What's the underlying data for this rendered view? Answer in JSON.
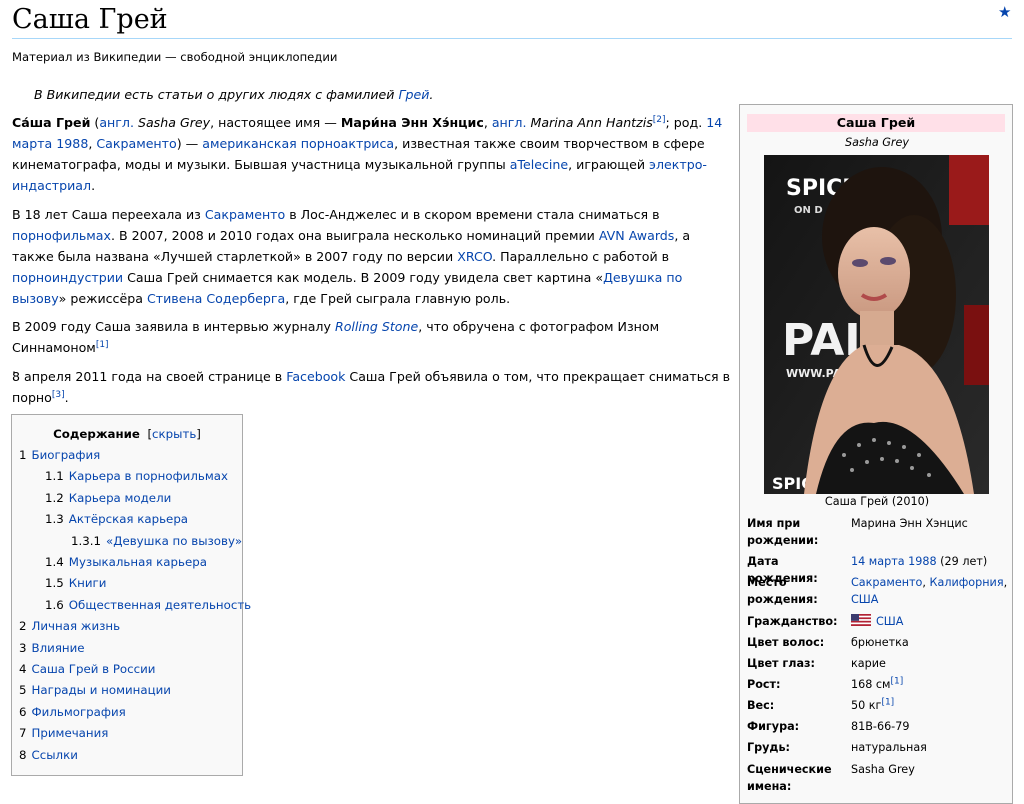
{
  "header": {
    "title": "Саша Грей",
    "tagline": "Материал из Википедии — свободной энциклопедии",
    "star_icon": "★"
  },
  "hatnote": {
    "text": "В Википедии есть статьи о других людях с фамилией ",
    "link": "Грей",
    "end": "."
  },
  "p1": {
    "name_bold": "Са́ша Грей",
    "t1": " (",
    "l1": "англ.",
    "t2": " ",
    "i1": "Sasha Grey",
    "t3": ", настоящее имя — ",
    "b2": "Мари́на Энн Хэ́нцис",
    "t4": ", ",
    "l2": "англ.",
    "t5": " ",
    "i2": "Marina Ann Hantzis",
    "s1": "[2]",
    "t6": "; род. ",
    "l3": "14 марта",
    "t7": " ",
    "l4": "1988",
    "t8": ", ",
    "l5": "Сакраменто",
    "t9": ") — ",
    "l6": "американская",
    "t10": " ",
    "l7": "порноактриса",
    "t11": ", известная также своим творчеством в сфере кинематографа, моды и музыки. Бывшая участница музыкальной группы ",
    "l8": "aTelecine",
    "t12": ", играющей ",
    "l9": "электро-индастриал",
    "t13": "."
  },
  "p2": {
    "t1": "В 18 лет Саша переехала из ",
    "l1": "Сакраменто",
    "t2": " в Лос-Анджелес и в скором времени стала сниматься в ",
    "l2": "порнофильмах",
    "t3": ". В 2007, 2008 и 2010 годах она выиграла несколько номинаций премии ",
    "l3": "AVN Awards",
    "t4": ", а также была названа «Лучшей старлеткой» в 2007 году по версии ",
    "l4": "XRCO",
    "t5": ". Параллельно с работой в ",
    "l5": "порноиндустрии",
    "t6": " Саша Грей снимается как модель. В 2009 году увидела свет картина «",
    "l6": "Девушка по вызову",
    "t7": "» режиссёра ",
    "l7": "Стивена Содерберга",
    "t8": ", где Грей сыграла главную роль."
  },
  "p3": {
    "t1": "В 2009 году Саша заявила в интервью журналу ",
    "l1": "Rolling Stone",
    "t2": ", что обручена с фотографом Изном Синнамоном",
    "s1": "[1]",
    "t3": "."
  },
  "p4": {
    "t1": "8 апреля 2011 года на своей странице в ",
    "l1": "Facebook",
    "t2": " Саша Грей объявила о том, что прекращает сниматься в порно",
    "s1": "[3]",
    "t3": "."
  },
  "toc": {
    "title": "Содержание",
    "open": "[",
    "toggle": "скрыть",
    "close": "]",
    "items": [
      {
        "num": "1",
        "label": "Биография"
      },
      {
        "num": "1.1",
        "label": "Карьера в порнофильмах"
      },
      {
        "num": "1.2",
        "label": "Карьера модели"
      },
      {
        "num": "1.3",
        "label": "Актёрская карьера"
      },
      {
        "num": "1.3.1",
        "label": "«Девушка по вызову»"
      },
      {
        "num": "1.4",
        "label": "Музыкальная карьера"
      },
      {
        "num": "1.5",
        "label": "Книги"
      },
      {
        "num": "1.6",
        "label": "Общественная деятельность"
      },
      {
        "num": "2",
        "label": "Личная жизнь"
      },
      {
        "num": "3",
        "label": "Влияние"
      },
      {
        "num": "4",
        "label": "Саша Грей в России"
      },
      {
        "num": "5",
        "label": "Награды и номинации"
      },
      {
        "num": "6",
        "label": "Фильмография"
      },
      {
        "num": "7",
        "label": "Примечания"
      },
      {
        "num": "8",
        "label": "Ссылки"
      }
    ]
  },
  "infobox": {
    "name": "Саша Грей",
    "alt_name": "Sasha Grey",
    "photo_sign_1": "SPICE",
    "photo_sign_2": "ON D",
    "photo_sign_3": "PALM",
    "photo_sign_4": "WWW.PAL",
    "photo_sign_5": "SPIC",
    "caption": "Саша Грей (2010)",
    "birth_name_label": "Имя при рождении:",
    "birth_name": "Марина Энн Хэнцис",
    "birth_date_label": "Дата рождения:",
    "birth_date_link1": "14 марта",
    "birth_date_link2": "1988",
    "birth_date_age": " (29 лет)",
    "birth_place_label": "Место рождения:",
    "birth_place_link1": "Сакраменто",
    "birth_place_sep": ", ",
    "birth_place_link2": "Калифорния",
    "birth_place_sep2": ",",
    "birth_place_link3": "США",
    "citizenship_label": "Гражданство:",
    "citizenship": "США",
    "hair_label": "Цвет волос:",
    "hair": "брюнетка",
    "eyes_label": "Цвет глаз:",
    "eyes": "карие",
    "height_label": "Рост:",
    "height": "168 см",
    "height_ref": "[1]",
    "weight_label": "Вес:",
    "weight": "50 кг",
    "weight_ref": "[1]",
    "figure_label": "Фигура:",
    "figure": "81B-66-79",
    "breast_label": "Грудь:",
    "breast": "натуральная",
    "stage_label": "Сценические имена:",
    "stage": "Sasha Grey"
  },
  "colors": {
    "link": "#0645ad",
    "infobox_header": "#ffe0e8",
    "border": "#aaaaaa",
    "panel_bg": "#f9f9f9"
  }
}
